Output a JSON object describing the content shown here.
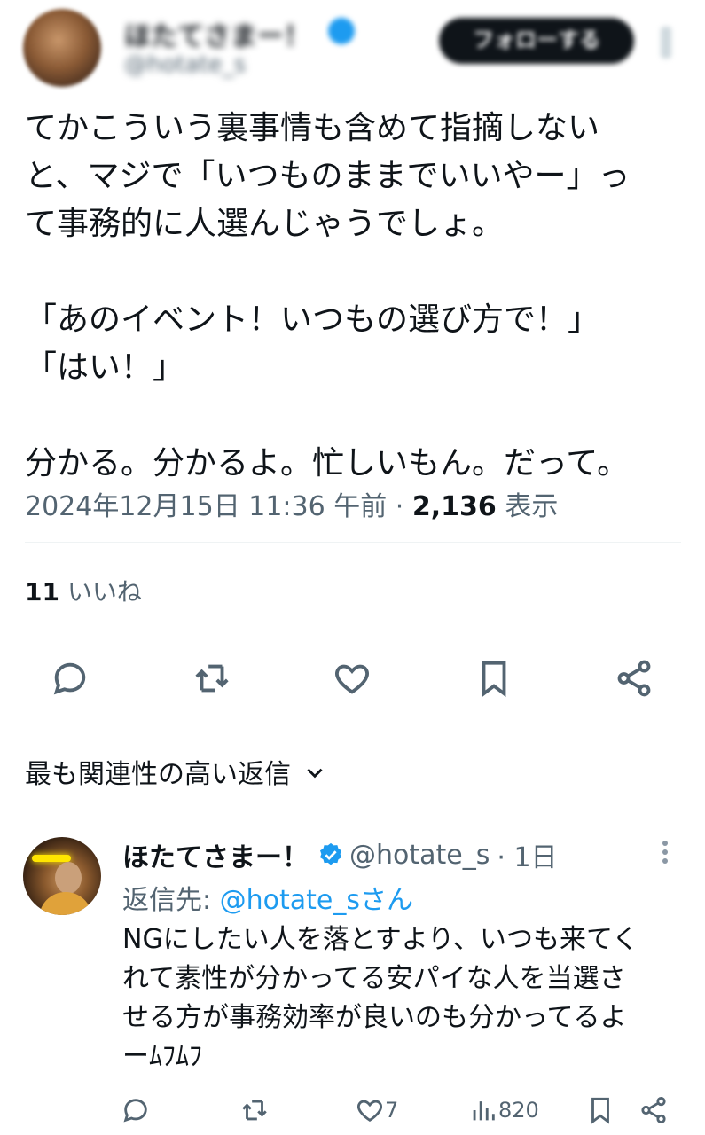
{
  "tweet": {
    "lines": [
      "てかこういう裏事情も含めて指摘しない",
      "と、マジで「いつものままでいいやー」っ",
      "て事務的に人選んじゃうでしょ。",
      "",
      "「あのイベント！いつもの選び方で！」",
      "「はい！」",
      "",
      "分かる。分かるよ。忙しいもん。だって。"
    ],
    "timestamp": "2024年12月15日 11:36 午前",
    "separator": "·",
    "views": "2,136",
    "views_label": "表示",
    "likes_count": "11",
    "likes_label": "いいね"
  },
  "sort": {
    "label": "最も関連性の高い返信"
  },
  "reply": {
    "name": "ほたてさまー！",
    "handle": "@hotate_s",
    "time": "· 1日",
    "reply_to_label": "返信先: ",
    "reply_to_handle": "@hotate_sさん",
    "lines": [
      "NGにしたい人を落とすより、いつも来てく",
      "れて素性が分かってる安パイな人を当選さ",
      "せる方が事務効率が良いのも分かってるよ",
      "ーﾑﾌﾑﾌ"
    ],
    "likes": "7",
    "views": "820"
  },
  "colors": {
    "accent": "#1d9bf0",
    "text": "#0f1419",
    "muted": "#536471"
  }
}
